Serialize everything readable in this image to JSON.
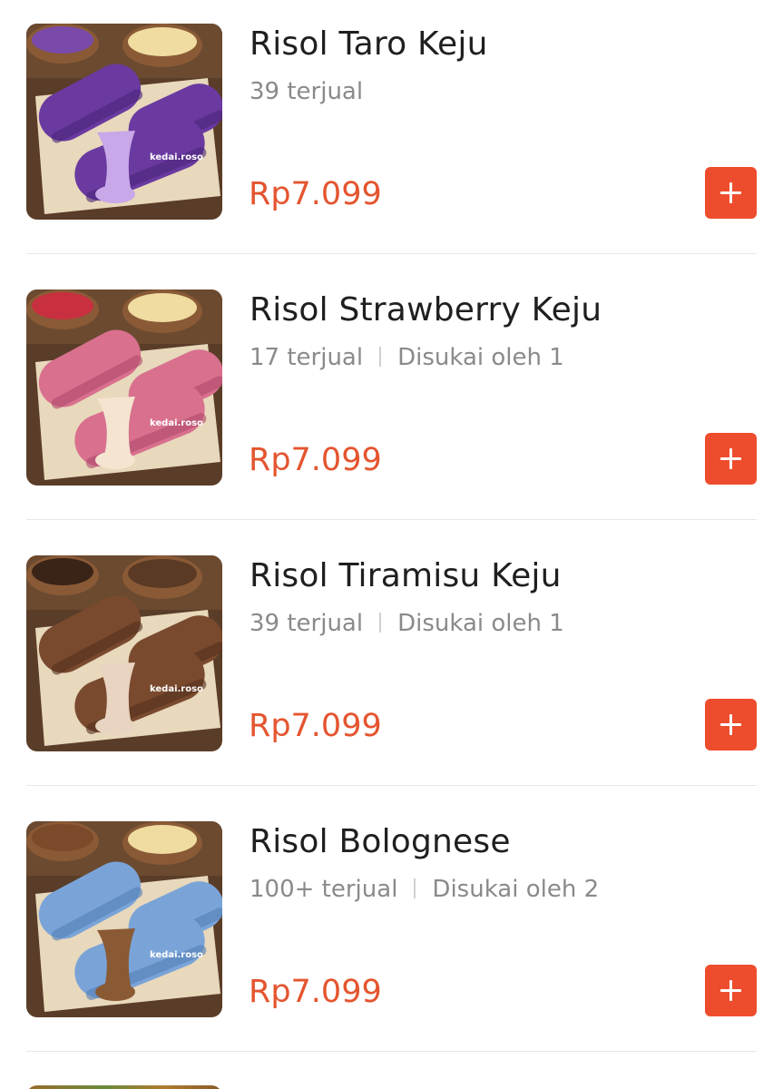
{
  "products": [
    {
      "name": "Risol Taro Keju",
      "sold": "39 terjual",
      "liked": "",
      "price": "Rp7.099",
      "watermark": "kedai.roso",
      "colors": {
        "wrap": "#6a3aa0",
        "wrap_dark": "#4a2478",
        "filling": "#c8a8e8",
        "bowl_left": "#7a4aaa",
        "bowl_right": "#f0dca0"
      }
    },
    {
      "name": "Risol Strawberry Keju",
      "sold": "17 terjual",
      "liked": "Disukai oleh 1",
      "price": "Rp7.099",
      "watermark": "kedai.roso",
      "colors": {
        "wrap": "#d8708e",
        "wrap_dark": "#b04a6a",
        "filling": "#f4e4d0",
        "bowl_left": "#c83040",
        "bowl_right": "#f0dca0"
      }
    },
    {
      "name": "Risol Tiramisu Keju",
      "sold": "39 terjual",
      "liked": "Disukai oleh 1",
      "price": "Rp7.099",
      "watermark": "kedai.roso",
      "colors": {
        "wrap": "#7a4a2e",
        "wrap_dark": "#54301c",
        "filling": "#e8d4c0",
        "bowl_left": "#3a2418",
        "bowl_right": "#5a3a24"
      }
    },
    {
      "name": "Risol Bolognese",
      "sold": "100+ terjual",
      "liked": "Disukai oleh 2",
      "price": "Rp7.099",
      "watermark": "kedai.roso",
      "colors": {
        "wrap": "#7aa4d8",
        "wrap_dark": "#5280b8",
        "filling": "#8a5a34",
        "bowl_left": "#7a4a2a",
        "bowl_right": "#f0dca0"
      }
    }
  ],
  "icons": {
    "add": "plus-icon"
  },
  "theme": {
    "accent": "#ee4d2d",
    "price_color": "#e4552f"
  }
}
